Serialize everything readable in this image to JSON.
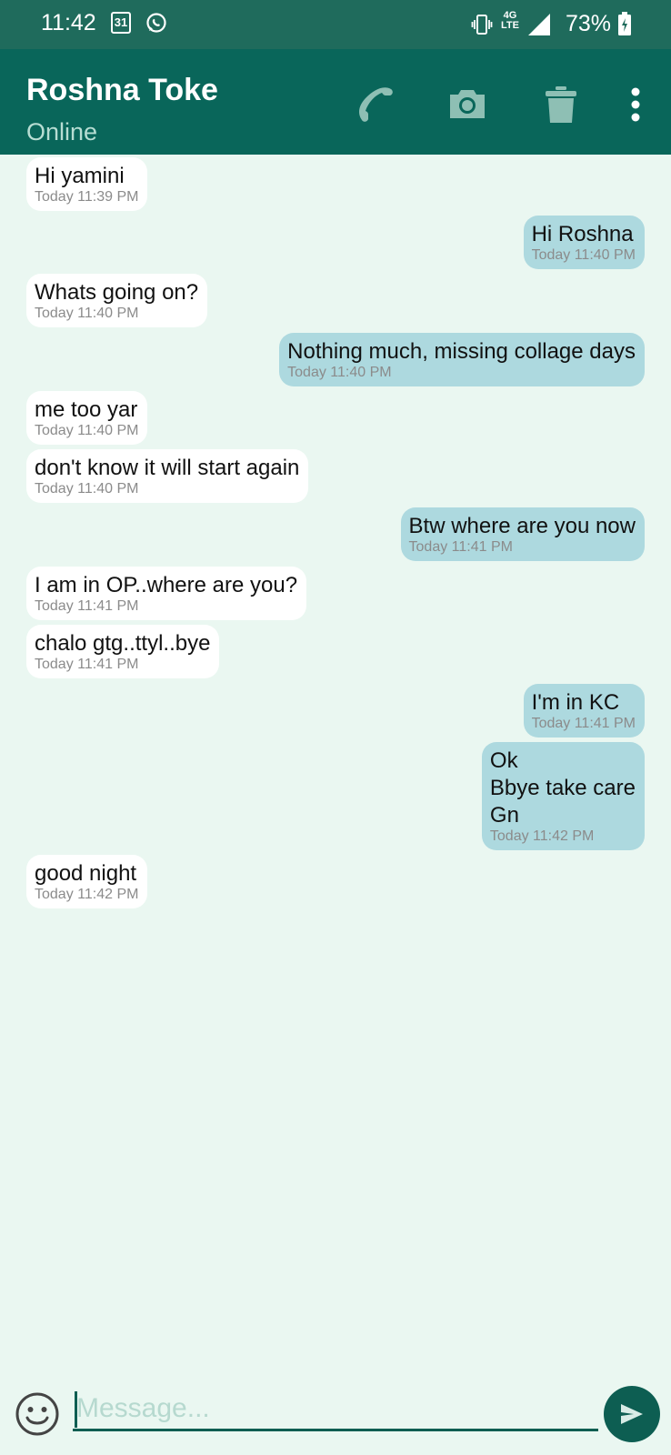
{
  "status_bar": {
    "time": "11:42",
    "calendar_day": "31",
    "network_top": "4G",
    "network_bottom": "LTE",
    "battery_percent": "73%",
    "icons": [
      "calendar-icon",
      "whatsapp-icon",
      "vibrate-icon",
      "signal-icon",
      "battery-charging-icon"
    ]
  },
  "header": {
    "contact_name": "Roshna Toke",
    "status": "Online",
    "actions": [
      "call-icon",
      "camera-icon",
      "trash-icon",
      "more-vert-icon"
    ]
  },
  "messages": [
    {
      "direction": "in",
      "text": "Hi yamini",
      "timestamp": "Today 11:39 PM"
    },
    {
      "direction": "out",
      "text": "Hi Roshna",
      "timestamp": "Today 11:40 PM"
    },
    {
      "direction": "in",
      "text": "Whats going on?",
      "timestamp": "Today 11:40 PM"
    },
    {
      "direction": "out",
      "text": "Nothing much, missing collage days",
      "timestamp": "Today 11:40 PM"
    },
    {
      "direction": "in",
      "text": "me too yar",
      "timestamp": "Today 11:40 PM"
    },
    {
      "direction": "in",
      "text": "don't know it will start again",
      "timestamp": "Today 11:40 PM"
    },
    {
      "direction": "out",
      "text": "Btw where are you now",
      "timestamp": "Today 11:41 PM"
    },
    {
      "direction": "in",
      "text": "I am in OP..where are you?",
      "timestamp": "Today 11:41 PM"
    },
    {
      "direction": "in",
      "text": "chalo gtg..ttyl..bye",
      "timestamp": "Today 11:41 PM"
    },
    {
      "direction": "out",
      "text": "I'm in KC",
      "timestamp": "Today 11:41 PM"
    },
    {
      "direction": "out",
      "text": "Ok\nBbye take care\nGn",
      "timestamp": "Today 11:42 PM"
    },
    {
      "direction": "in",
      "text": "good night",
      "timestamp": "Today 11:42 PM"
    }
  ],
  "composer": {
    "placeholder": "Message...",
    "value": "",
    "icons": [
      "emoji-icon",
      "send-icon"
    ]
  },
  "colors": {
    "status_bar": "#1f6b5c",
    "app_bar": "#09665a",
    "background": "#eaf7f1",
    "incoming_bubble": "#ffffff",
    "outgoing_bubble": "#add9df",
    "accent": "#0d5e52"
  }
}
